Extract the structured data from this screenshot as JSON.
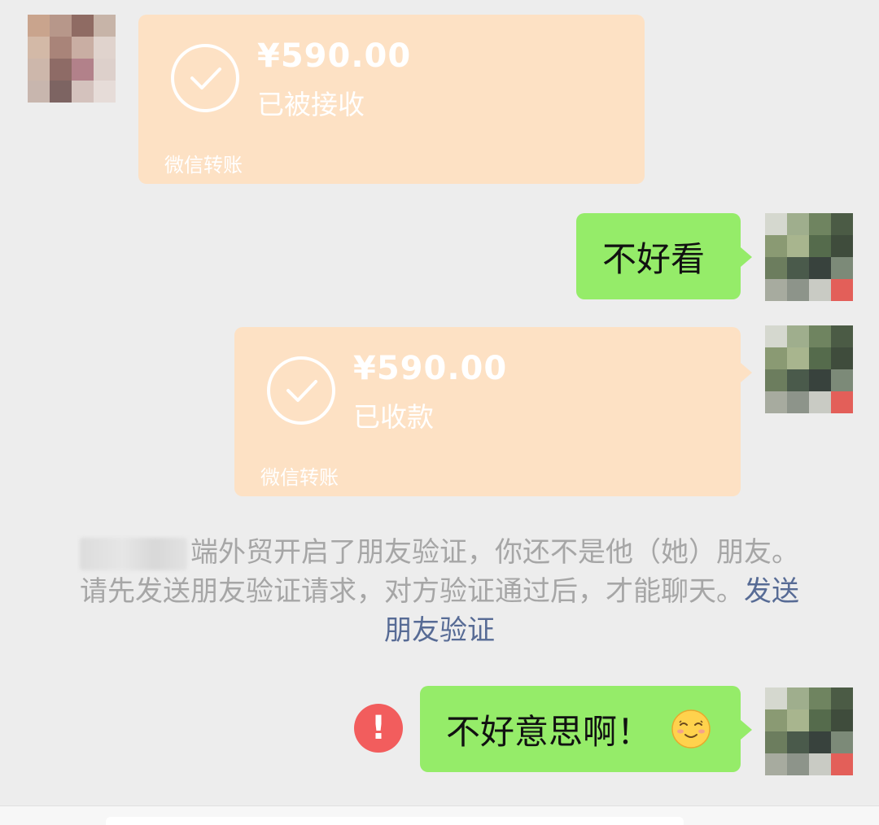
{
  "messages": {
    "transfer_received": {
      "amount": "¥590.00",
      "status": "已被接收",
      "footer": "微信转账"
    },
    "text_1": "不好看",
    "transfer_collected": {
      "amount": "¥590.00",
      "status": "已收款",
      "footer": "微信转账"
    },
    "system_notice": {
      "text": "端外贸开启了朋友验证，你还不是他（她）朋友。请先发送朋友验证请求，对方验证通过后，才能聊天。",
      "link": "发送朋友验证"
    },
    "text_2": "不好意思啊！"
  },
  "icons": {
    "transfer_status": "check-circle-icon",
    "send_failed": "exclamation-icon",
    "emoji": "smiling-face-icon"
  },
  "colors": {
    "background": "#ededed",
    "transfer_card": "#fde1c4",
    "sent_bubble": "#95ec69",
    "error": "#f25d5d",
    "link": "#576b95"
  }
}
